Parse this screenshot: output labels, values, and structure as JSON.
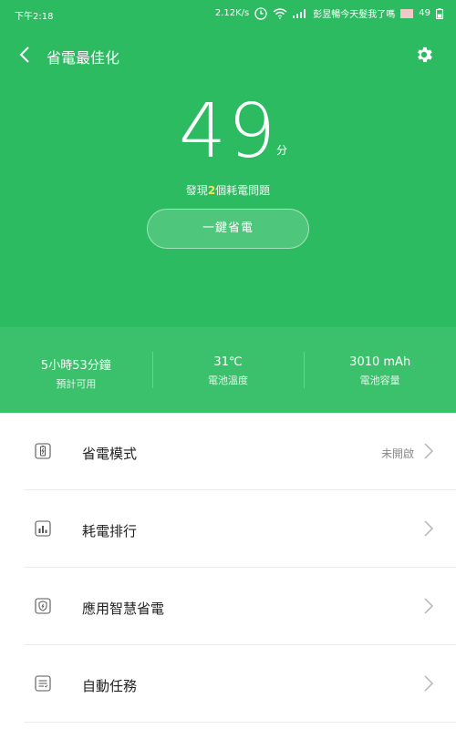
{
  "status_bar": {
    "time": "下午2:18",
    "network_speed": "2.12K/s",
    "carrier": "彭昱暢今天髮我了嗎",
    "battery_level": "49"
  },
  "header": {
    "title": "省電最佳化"
  },
  "score": {
    "value": "49",
    "unit": "分",
    "issues_prefix": "發現",
    "issues_count": "2",
    "issues_suffix": "個耗電問題",
    "action_label": "一鍵省電"
  },
  "stats": [
    {
      "value": "5小時53分鐘",
      "label": "預計可用"
    },
    {
      "value": "31℃",
      "label": "電池溫度"
    },
    {
      "value": "3010 mAh",
      "label": "電池容量"
    }
  ],
  "menu": [
    {
      "label": "省電模式",
      "value": "未開啟",
      "icon": "battery-mode-icon"
    },
    {
      "label": "耗電排行",
      "value": "",
      "icon": "ranking-icon"
    },
    {
      "label": "應用智慧省電",
      "value": "",
      "icon": "smart-shield-icon"
    },
    {
      "label": "自動任務",
      "value": "",
      "icon": "task-list-icon"
    }
  ],
  "colors": {
    "primary_green": "#2dbb62",
    "stats_green": "#3bc06c",
    "highlight_yellow": "#ffe95b"
  }
}
